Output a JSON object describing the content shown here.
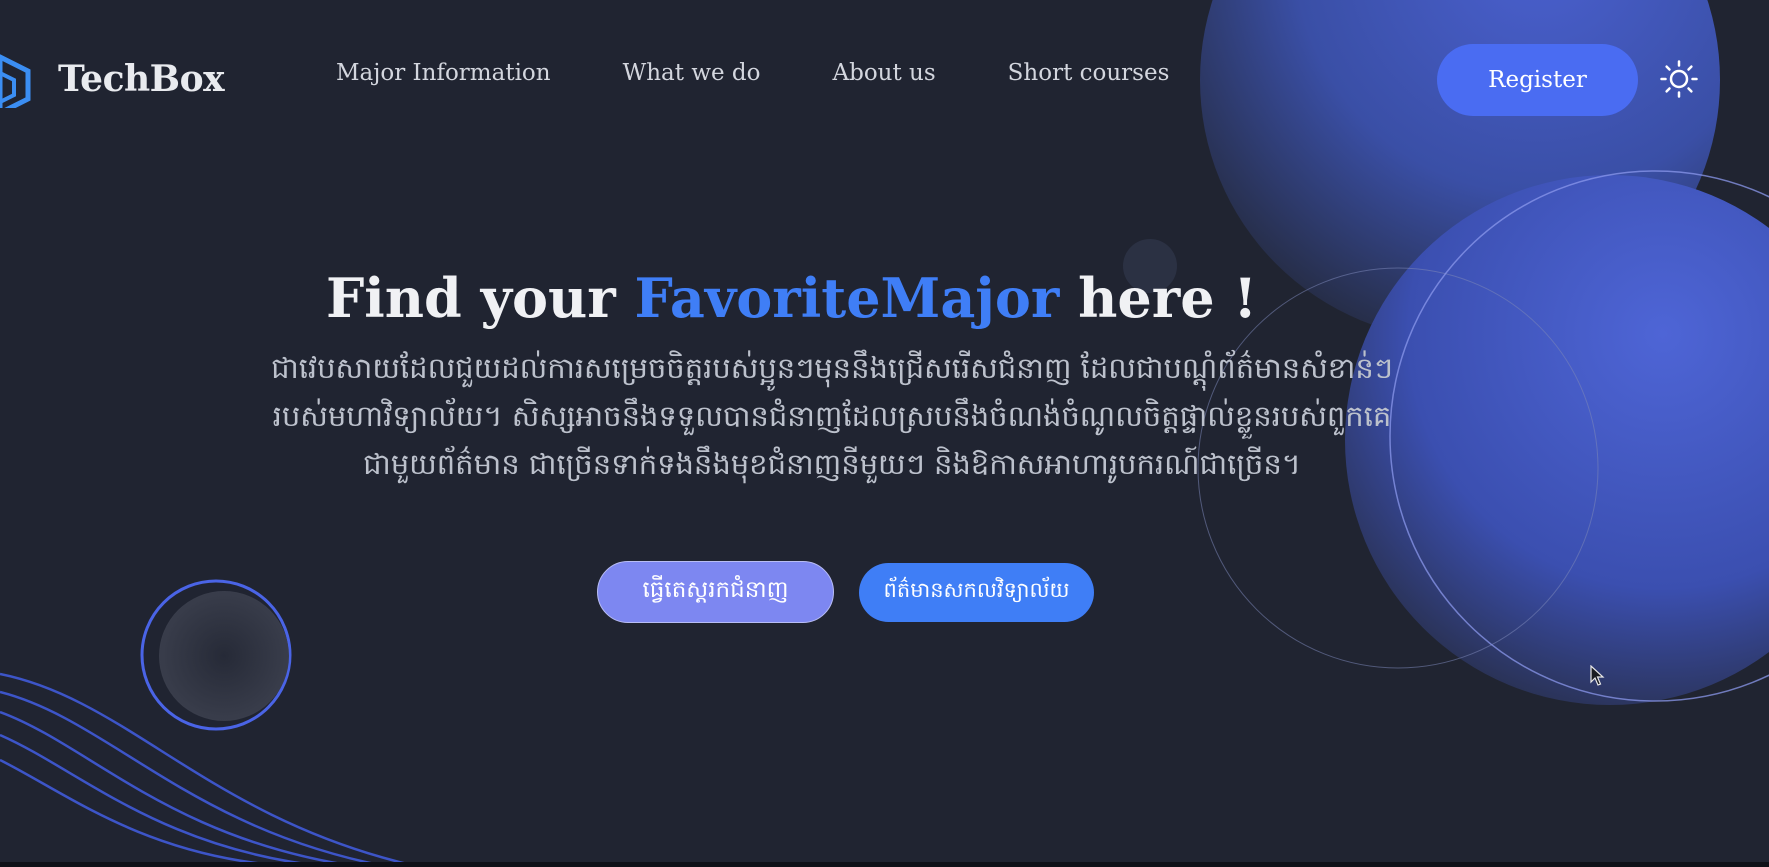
{
  "brand": {
    "name": "TechBox"
  },
  "nav": {
    "items": [
      {
        "label": "Major Information"
      },
      {
        "label": "What we do"
      },
      {
        "label": "About us"
      },
      {
        "label": "Short courses"
      }
    ],
    "register_label": "Register"
  },
  "hero": {
    "title_prefix": "Find your ",
    "title_accent": "FavoriteMajor",
    "title_suffix": " here !",
    "description": "ជាវេបសាយដែលជួយដល់ការសម្រេចចិត្តរបស់ប្អូនៗមុននឹងជ្រើសរើសជំនាញ ដែលជាបណ្តុំព័ត៌មានសំខាន់ៗរបស់មហាវិទ្យាល័យ។ សិស្សអាចនឹងទទួលបានជំនាញដែលស្របនឹងចំណង់ចំណូលចិត្តផ្ទាល់ខ្លួនរបស់ពួកគេ ជាមួយព័ត៌មាន ជាច្រើនទាក់ទងនឹងមុខជំនាញនីមួយៗ និងឱកាសអាហារូបករណ៍ជាច្រើន។",
    "primary_cta": "ធ្វើតេស្តរកជំនាញ",
    "secondary_cta": "ព័ត៌មានសកលវិទ្យាល័យ"
  },
  "colors": {
    "background": "#202431",
    "accent_blue": "#3f7ef6",
    "register_blue": "#4a6cf2",
    "quiz_purple": "#7d87f1"
  },
  "icons": {
    "logo": "hexagon-logo-icon",
    "theme_toggle": "sun-icon"
  }
}
